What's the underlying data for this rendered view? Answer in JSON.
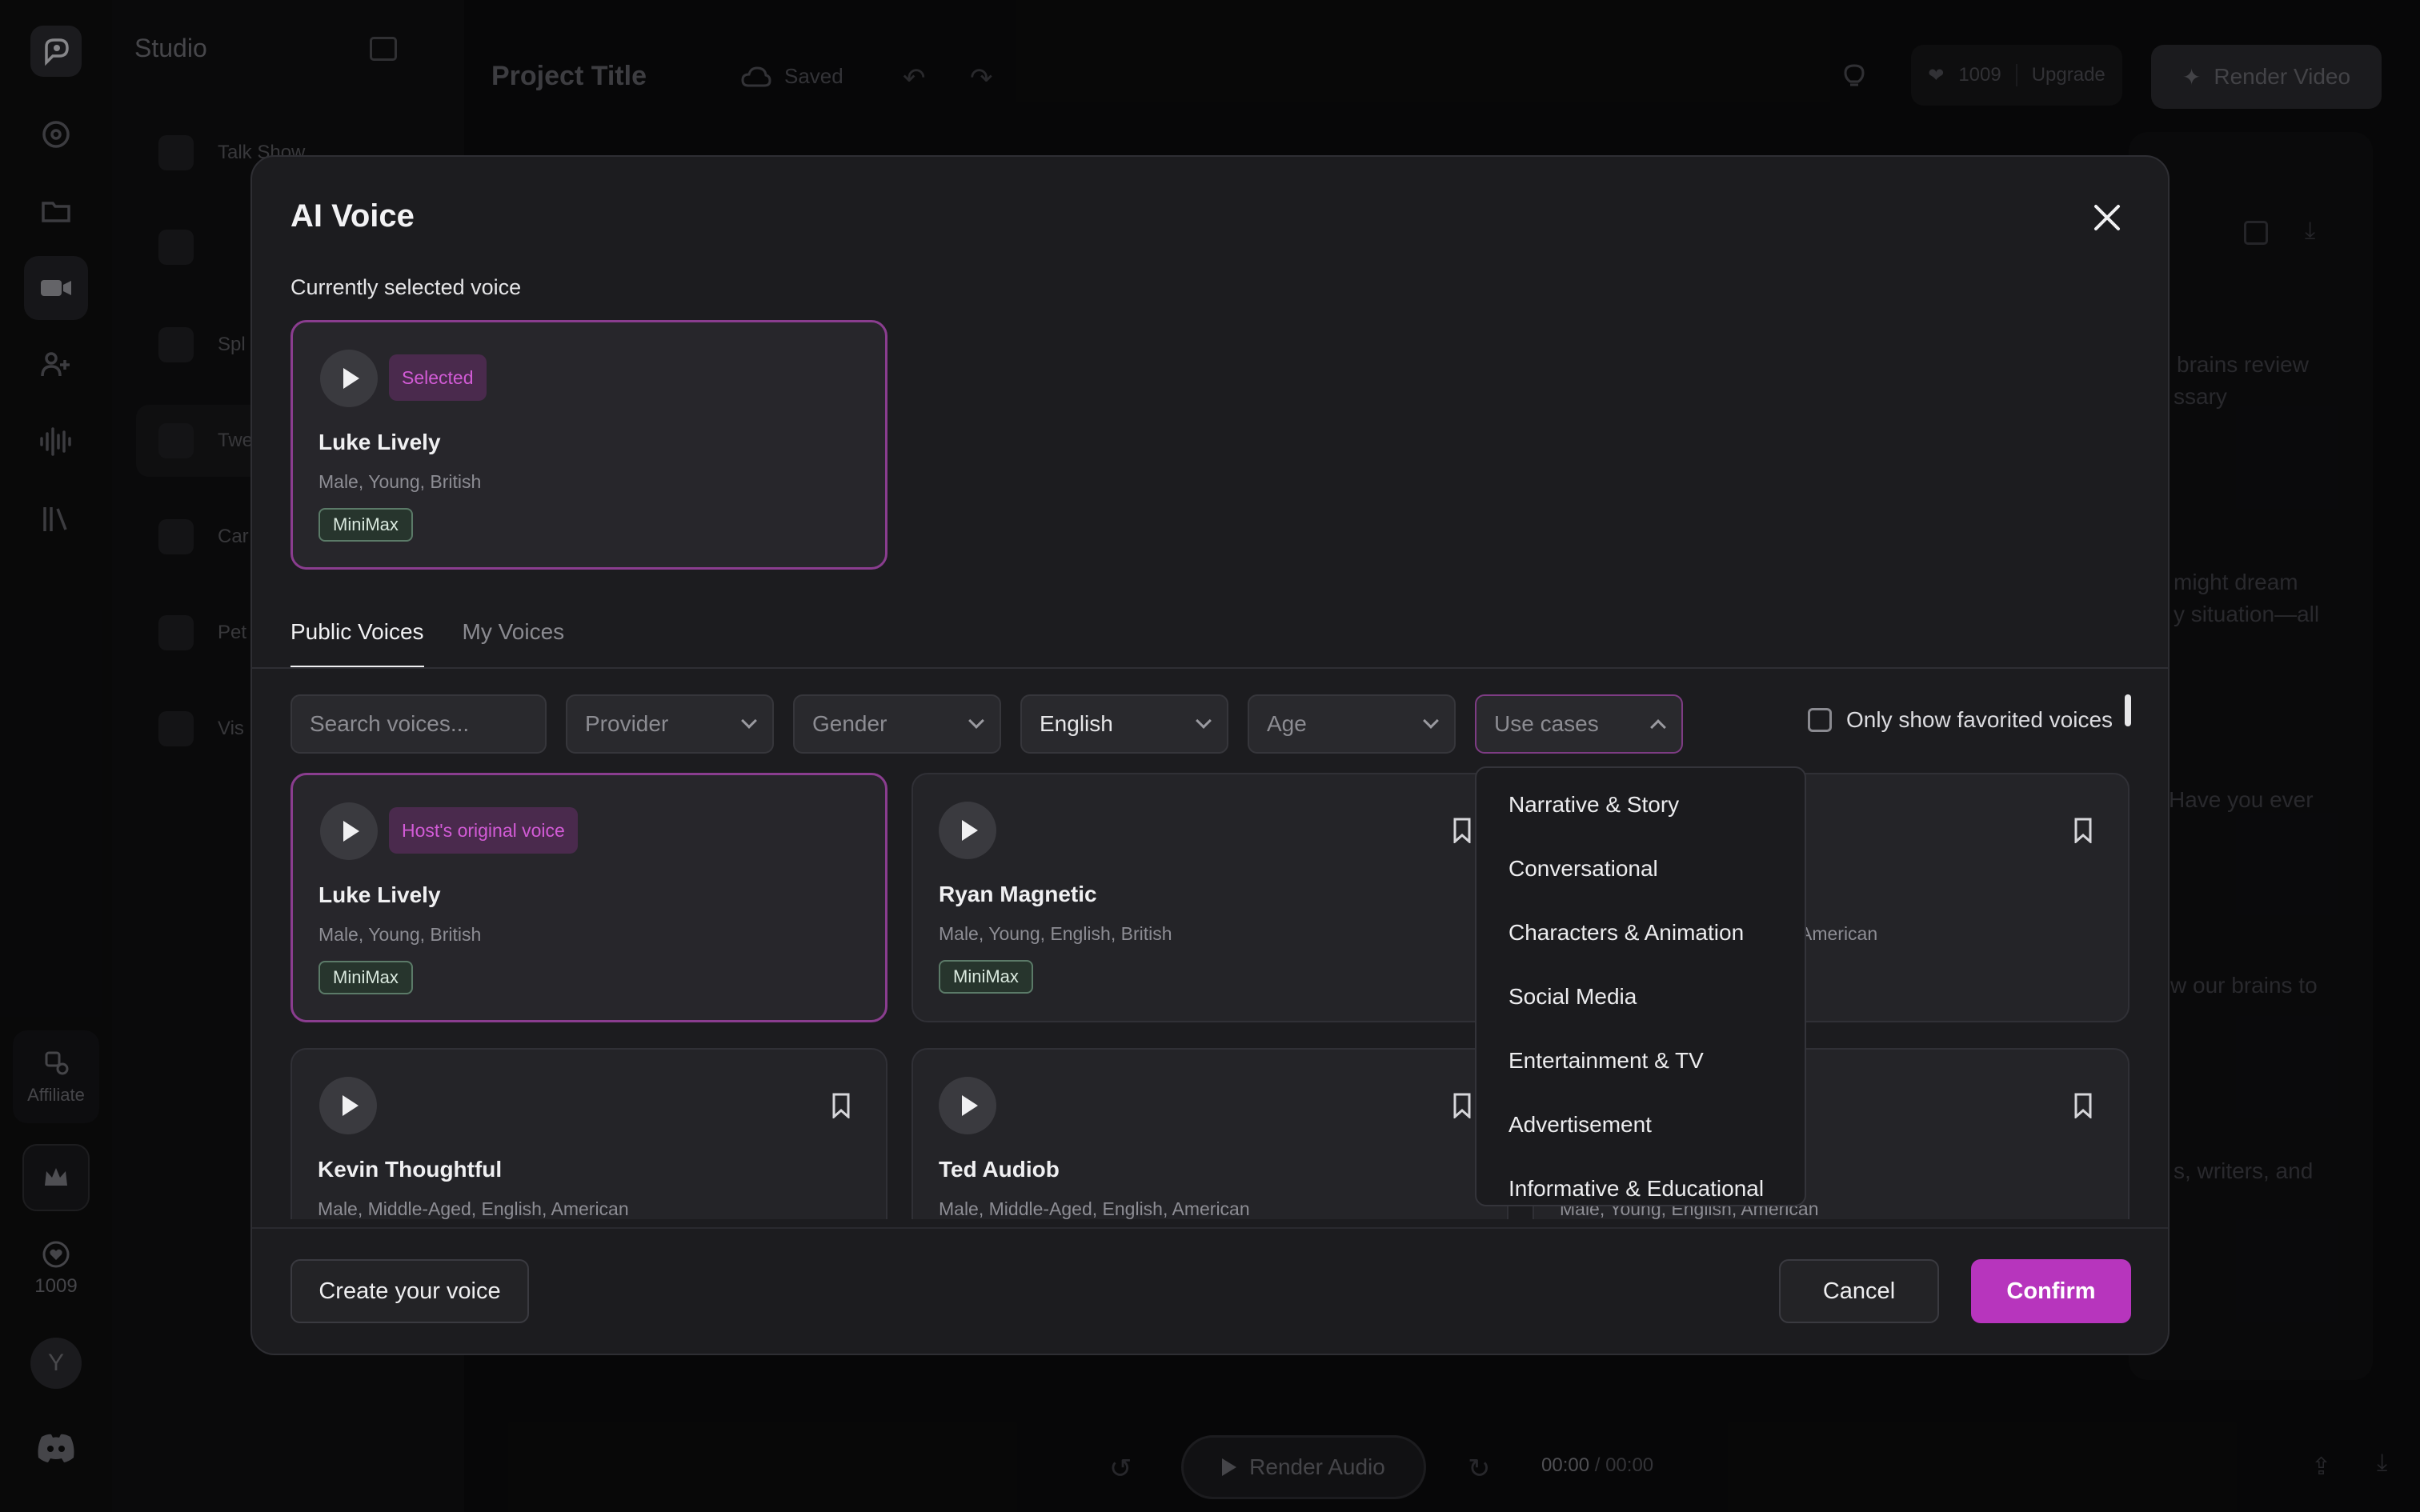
{
  "rail": {
    "affiliate_label": "Affiliate",
    "credits": "1009",
    "avatar_initial": "Y"
  },
  "studio": {
    "title": "Studio",
    "items": [
      "Talk Show",
      "",
      "Spl",
      "Twe",
      "Car",
      "Pet",
      "Vis"
    ]
  },
  "topbar": {
    "project_title": "Project Title",
    "save_status": "Saved",
    "credits": "1009",
    "upgrade_label": "Upgrade",
    "render_video_label": "Render Video"
  },
  "editor": {
    "snippets": [
      "brains review",
      "ssary",
      "might dream",
      "y situation—all",
      "Have you ever",
      "w our brains to",
      "s, writers, and"
    ]
  },
  "bottombar": {
    "render_audio_label": "Render Audio",
    "time_current": "00:00",
    "time_total": "00:00"
  },
  "modal": {
    "title": "AI Voice",
    "current_section_label": "Currently selected voice",
    "current_voice": {
      "badge": "Selected",
      "name": "Luke Lively",
      "description": "Male, Young, British",
      "provider": "MiniMax"
    },
    "tabs": [
      "Public Voices",
      "My Voices"
    ],
    "filters": {
      "search_placeholder": "Search voices...",
      "provider": "Provider",
      "gender": "Gender",
      "language": "English",
      "age": "Age",
      "use_cases": "Use cases",
      "favorites_label": "Only show favorited voices"
    },
    "voices": [
      {
        "name": "Luke Lively",
        "description": "Male, Young, British",
        "badge": "Host's original voice",
        "provider": "MiniMax"
      },
      {
        "name": "Ryan Magnetic",
        "description": "Male, Young, English, British",
        "provider": "MiniMax"
      },
      {
        "name": "",
        "description": "American"
      },
      {
        "name": "Kevin Thoughtful",
        "description": "Male, Middle-Aged, English, American"
      },
      {
        "name": "Ted Audiob",
        "description": "Male, Middle-Aged, English, American"
      },
      {
        "name": "",
        "description": "Male, Young, English, American"
      }
    ],
    "use_case_options": [
      "Narrative & Story",
      "Conversational",
      "Characters & Animation",
      "Social Media",
      "Entertainment & TV",
      "Advertisement",
      "Informative & Educational"
    ],
    "create_label": "Create your voice",
    "cancel_label": "Cancel",
    "confirm_label": "Confirm"
  },
  "colors": {
    "accent": "#b735bd",
    "selected_border": "#8a3d8f",
    "provider_tag": "#5b7a68"
  }
}
